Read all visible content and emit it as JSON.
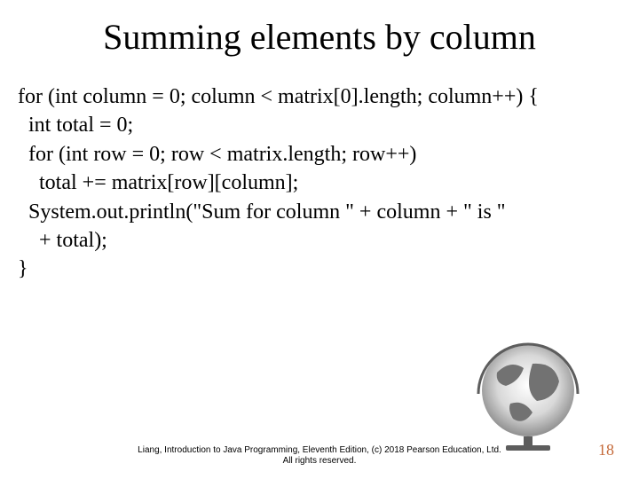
{
  "title": "Summing elements by column",
  "code": {
    "line1": "for (int column = 0; column < matrix[0].length; column++) {",
    "line2": "  int total = 0;",
    "line3": "  for (int row = 0; row < matrix.length; row++)",
    "line4": "    total += matrix[row][column];",
    "line5": "  System.out.println(\"Sum for column \" + column + \" is \"",
    "line6": "    + total);",
    "line7": "}"
  },
  "footer": {
    "line1": "Liang, Introduction to Java Programming, Eleventh Edition, (c) 2018 Pearson Education, Ltd.",
    "line2": "All rights reserved."
  },
  "page_number": "18"
}
